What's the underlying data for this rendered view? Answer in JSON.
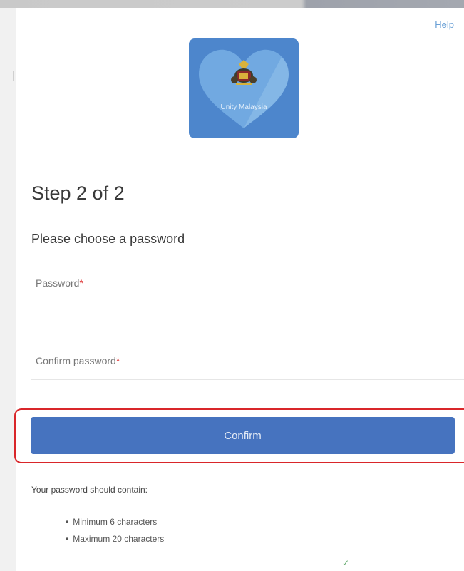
{
  "header": {
    "help_label": "Help"
  },
  "logo": {
    "name": "heart-crest-logo",
    "text": "Unity Malaysia",
    "colors": {
      "background": "#4d86cc",
      "heart": "#7eb4e8"
    }
  },
  "form": {
    "step_title": "Step 2 of 2",
    "subtitle": "Please choose a password",
    "password_label": "Password",
    "confirm_password_label": "Confirm password",
    "required_marker": "*",
    "confirm_button": "Confirm"
  },
  "requirements": {
    "intro": "Your password should contain:",
    "items": [
      "Minimum 6 characters",
      "Maximum 20 characters"
    ]
  },
  "colors": {
    "accent": "#4673bf",
    "required": "#e03c3c",
    "highlight": "#d9262a",
    "link": "#6aa0d6"
  }
}
